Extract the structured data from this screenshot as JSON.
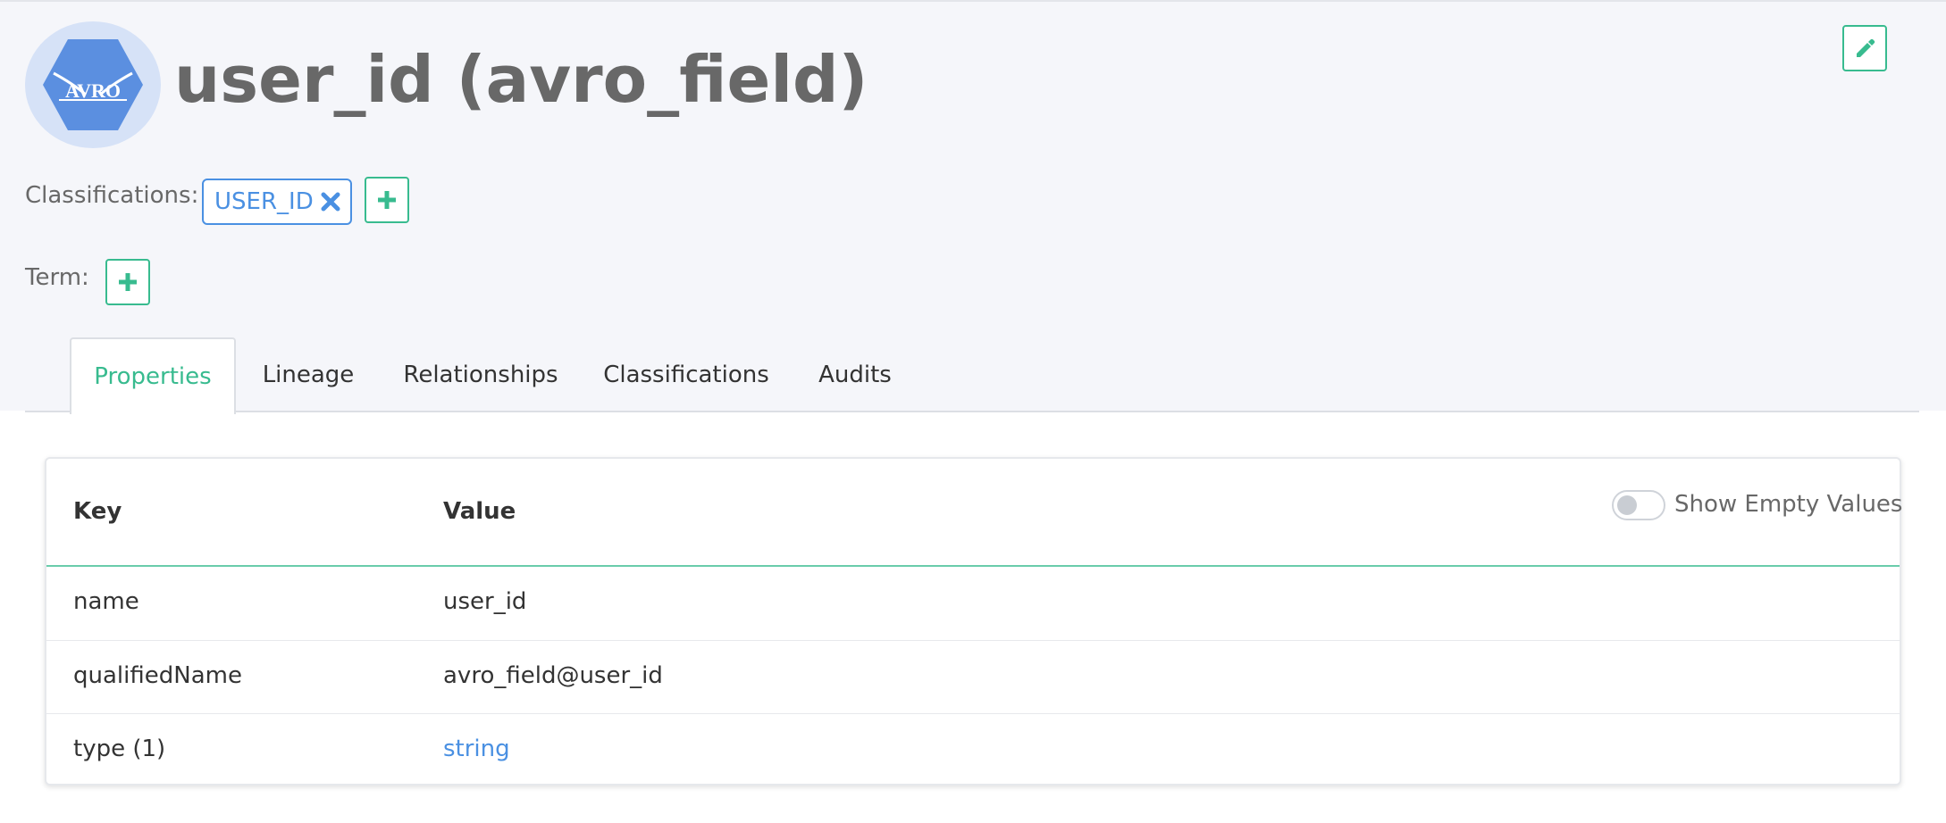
{
  "entity": {
    "icon": "avro-hexagon-icon",
    "logo_text": "AVRO",
    "title": "user_id (avro_field)"
  },
  "classifications": {
    "label": "Classifications:",
    "tags": [
      {
        "name": "USER_ID",
        "remove_icon": "close-x-icon"
      }
    ],
    "add_icon": "plus-icon"
  },
  "term": {
    "label": "Term:",
    "add_icon": "plus-icon"
  },
  "edit_icon": "pencil-icon",
  "tabs": [
    {
      "label": "Properties",
      "active": true
    },
    {
      "label": "Lineage",
      "active": false
    },
    {
      "label": "Relationships",
      "active": false
    },
    {
      "label": "Classifications",
      "active": false
    },
    {
      "label": "Audits",
      "active": false
    }
  ],
  "properties_table": {
    "headers": {
      "key": "Key",
      "value": "Value"
    },
    "show_empty_values": {
      "label": "Show Empty Values",
      "enabled": false
    },
    "rows": [
      {
        "key": "name",
        "value": "user_id",
        "is_link": false
      },
      {
        "key": "qualifiedName",
        "value": "avro_field@user_id",
        "is_link": false
      },
      {
        "key": "type (1)",
        "value": "string",
        "is_link": true
      }
    ]
  },
  "colors": {
    "accent_green": "#38bb8f",
    "link_blue": "#4a90e2",
    "header_bg": "#f5f6fa",
    "logo_hex": "#5b8fe0",
    "logo_circle": "#d6e2f7"
  }
}
